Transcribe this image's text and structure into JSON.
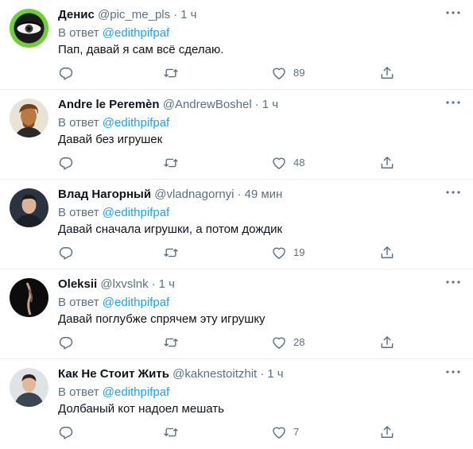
{
  "reply_prefix": "В ответ",
  "tweets": [
    {
      "name": "Денис",
      "handle": "@pic_me_pls",
      "time": "1 ч",
      "reply_to": "@edithpifpaf",
      "text": "Пап, давай я сам всё сделаю.",
      "likes": "89",
      "avatar": "eye-avatar"
    },
    {
      "name": "Andre le Peremèn",
      "handle": "@AndrewBoshel",
      "time": "1 ч",
      "reply_to": "@edithpifpaf",
      "text": "Давай без игрушек",
      "likes": "48",
      "avatar": "portrait-painting-avatar"
    },
    {
      "name": "Влад Нагорный",
      "handle": "@vladnagornyi",
      "time": "49 мин",
      "reply_to": "@edithpifpaf",
      "text": "Давай сначала игрушки, а потом дождик",
      "likes": "19",
      "avatar": "man-portrait-avatar"
    },
    {
      "name": "Oleksii",
      "handle": "@lxvslnk",
      "time": "1 ч",
      "reply_to": "@edithpifpaf",
      "text": "Давай поглубже спрячем эту игрушку",
      "likes": "28",
      "avatar": "dark-abstract-avatar"
    },
    {
      "name": "Как Не Стоит Жить",
      "handle": "@kaknestoitzhit",
      "time": "1 ч",
      "reply_to": "@edithpifpaf",
      "text": "Долбаный кот надоел мешать",
      "likes": "7",
      "avatar": "man-photo-avatar"
    }
  ],
  "colors": {
    "name": "#0f1419",
    "secondary": "#5b7083",
    "link": "#1da1f2",
    "divider": "#e6ecf0"
  },
  "icons": [
    "more-icon",
    "reply-icon",
    "retweet-icon",
    "like-icon",
    "share-icon"
  ]
}
